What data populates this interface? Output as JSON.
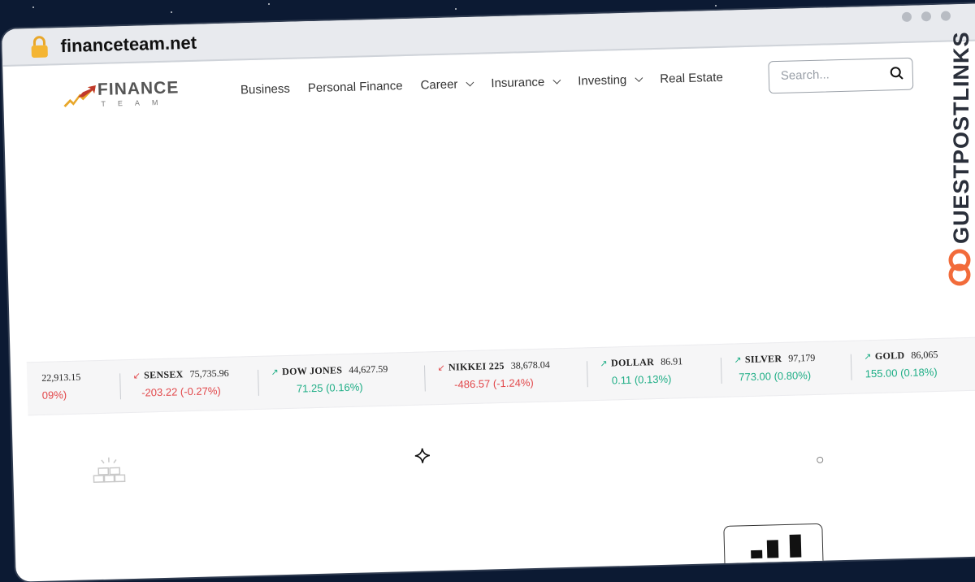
{
  "browser": {
    "url": "financeteam.net"
  },
  "header": {
    "logo_text": "FINANCE",
    "logo_sub": "TEAM",
    "nav": [
      {
        "label": "Business",
        "dropdown": false
      },
      {
        "label": "Personal Finance",
        "dropdown": false
      },
      {
        "label": "Career",
        "dropdown": true
      },
      {
        "label": "Insurance",
        "dropdown": true
      },
      {
        "label": "Investing",
        "dropdown": true
      },
      {
        "label": "Real Estate",
        "dropdown": false
      }
    ],
    "search_placeholder": "Search..."
  },
  "ticker": [
    {
      "name": "",
      "value": "22,913.15",
      "change": "09%)",
      "direction": "down"
    },
    {
      "name": "SENSEX",
      "value": "75,735.96",
      "change": "-203.22 (-0.27%)",
      "direction": "down"
    },
    {
      "name": "DOW JONES",
      "value": "44,627.59",
      "change": "71.25 (0.16%)",
      "direction": "up"
    },
    {
      "name": "NIKKEI 225",
      "value": "38,678.04",
      "change": "-486.57 (-1.24%)",
      "direction": "down"
    },
    {
      "name": "DOLLAR",
      "value": "86.91",
      "change": "0.11 (0.13%)",
      "direction": "up"
    },
    {
      "name": "SILVER",
      "value": "97,179",
      "change": "773.00 (0.80%)",
      "direction": "up"
    },
    {
      "name": "GOLD",
      "value": "86,065",
      "change": "155.00 (0.18%)",
      "direction": "up"
    }
  ],
  "colors": {
    "down": "#e2474a",
    "up": "#1fae86",
    "watermark_accent": "#f26b3a"
  },
  "watermark": {
    "text": "GUESTPOSTLINKS"
  }
}
